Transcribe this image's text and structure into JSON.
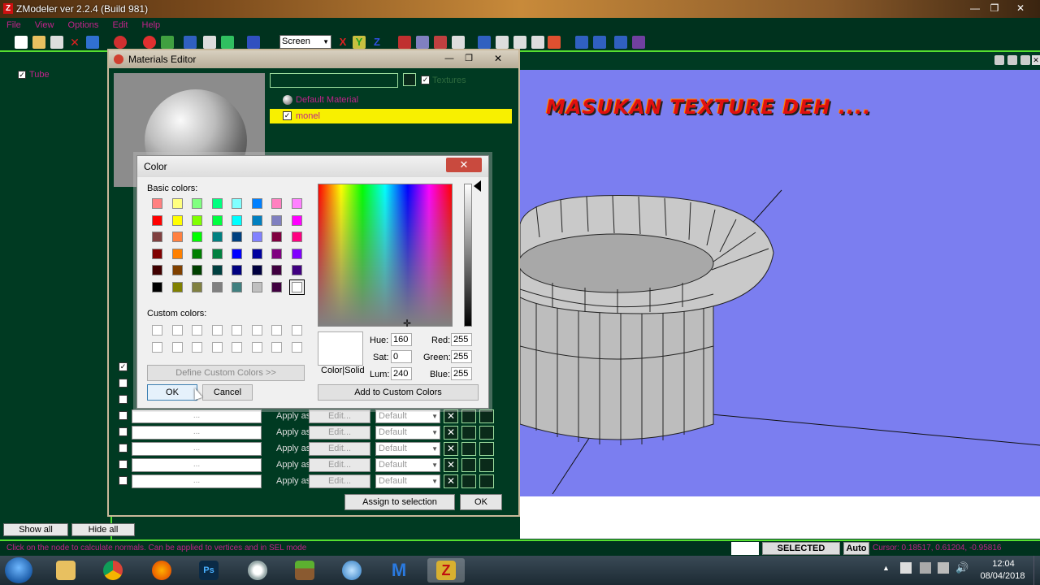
{
  "app": {
    "title": "ZModeler ver 2.2.4 (Build 981)",
    "menu": [
      "File",
      "View",
      "Options",
      "Edit",
      "Help"
    ]
  },
  "toolbar": {
    "view_select": "Screen"
  },
  "tree": {
    "items": [
      {
        "label": "Tube",
        "checked": true
      }
    ]
  },
  "left_buttons": {
    "show_all": "Show all",
    "hide_all": "Hide all"
  },
  "overlay_text": "MASUKAN TEXTURE DEH ....",
  "materials_editor": {
    "title": "Materials Editor",
    "textures_label": "Textures",
    "materials": [
      {
        "name": "Default Material",
        "checked": false
      },
      {
        "name": "monel",
        "checked": true
      }
    ],
    "slot_rows": [
      {
        "apply_label": "Apply as:",
        "edit_label": "Edit...",
        "mode": "Default",
        "slot_text": "..."
      },
      {
        "apply_label": "Apply as:",
        "edit_label": "Edit...",
        "mode": "Default",
        "slot_text": "..."
      },
      {
        "apply_label": "Apply as:",
        "edit_label": "Edit...",
        "mode": "Default",
        "slot_text": "..."
      },
      {
        "apply_label": "Apply as:",
        "edit_label": "Edit...",
        "mode": "Default",
        "slot_text": "..."
      },
      {
        "apply_label": "Apply as:",
        "edit_label": "Edit...",
        "mode": "Default",
        "slot_text": "..."
      }
    ],
    "assign_button": "Assign to selection",
    "ok_button": "OK"
  },
  "color_dialog": {
    "title": "Color",
    "basic_colors_label": "Basic colors:",
    "custom_colors_label": "Custom colors:",
    "define_custom_button": "Define Custom Colors >>",
    "ok_button": "OK",
    "cancel_button": "Cancel",
    "add_custom_button": "Add to Custom Colors",
    "color_solid_label": "Color|Solid",
    "hue_label": "Hue:",
    "hue": "160",
    "sat_label": "Sat:",
    "sat": "0",
    "lum_label": "Lum:",
    "lum": "240",
    "red_label": "Red:",
    "red": "255",
    "green_label": "Green:",
    "green": "255",
    "blue_label": "Blue:",
    "blue": "255",
    "basic_colors": [
      "#ff8080",
      "#ffff80",
      "#80ff80",
      "#00ff80",
      "#80ffff",
      "#0080ff",
      "#ff80c0",
      "#ff80ff",
      "#ff0000",
      "#ffff00",
      "#80ff00",
      "#00ff40",
      "#00ffff",
      "#0080c0",
      "#8080c0",
      "#ff00ff",
      "#804040",
      "#ff8040",
      "#00ff00",
      "#008080",
      "#004080",
      "#8080ff",
      "#800040",
      "#ff0080",
      "#800000",
      "#ff8000",
      "#008000",
      "#008040",
      "#0000ff",
      "#0000a0",
      "#800080",
      "#8000ff",
      "#400000",
      "#804000",
      "#004000",
      "#004040",
      "#000080",
      "#000040",
      "#400040",
      "#400080",
      "#000000",
      "#808000",
      "#808040",
      "#808080",
      "#408080",
      "#c0c0c0",
      "#400040",
      "#ffffff"
    ]
  },
  "status": {
    "hint": "Click on the node to calculate normals. Can be applied to vertices and in SEL mode",
    "mode": "SELECTED MODE",
    "auto": "Auto",
    "cursor": "Cursor: 0.18517, 0.61204, -0.95816"
  },
  "taskbar": {
    "time": "12:04",
    "date": "08/04/2018",
    "apps": [
      "explorer-icon",
      "chrome-icon",
      "firefox-icon",
      "photoshop-icon",
      "opera-icon",
      "minecraft-icon",
      "network-icon",
      "maxthon-icon",
      "zmodeler-icon"
    ]
  }
}
